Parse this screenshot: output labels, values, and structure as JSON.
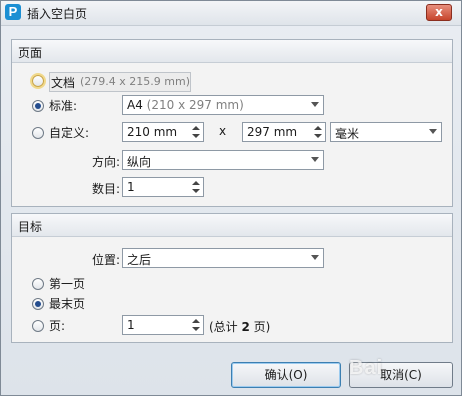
{
  "window": {
    "title": "插入空白页",
    "app_icon_letter": "P",
    "close_glyph": "x"
  },
  "page_group": {
    "title": "页面",
    "doc_option": {
      "label": "文档",
      "size": "(279.4 x 215.9 mm)"
    },
    "standard_option": {
      "label": "标准:",
      "value": "A4 ",
      "value_hint": "(210 x 297 mm)"
    },
    "custom_option": {
      "label": "自定义:",
      "width": "210 mm",
      "times": "x",
      "height": "297 mm",
      "unit": "毫米"
    },
    "orientation": {
      "label": "方向:",
      "value": "纵向"
    },
    "count": {
      "label": "数目:",
      "value": "1"
    }
  },
  "target_group": {
    "title": "目标",
    "position": {
      "label": "位置:",
      "value": "之后"
    },
    "first_page": {
      "label": "第一页"
    },
    "last_page": {
      "label": "最末页"
    },
    "page": {
      "label": "页:",
      "value": "1",
      "total_prefix": "(总计 ",
      "total_value": "2",
      "total_suffix": " 页)"
    }
  },
  "buttons": {
    "ok": "确认(O)",
    "cancel": "取消(C)"
  },
  "watermark": "Bai"
}
